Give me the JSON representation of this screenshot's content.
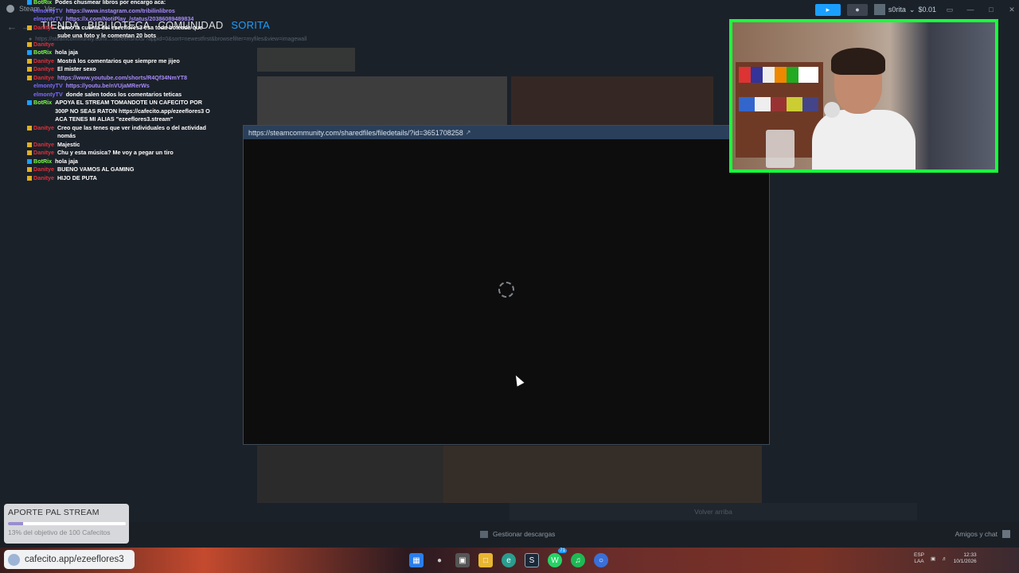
{
  "titlebar": {
    "app_name": "Steam",
    "menu_view": "Ver",
    "user_name": "s0rita",
    "balance": "$0.01"
  },
  "nav": {
    "tabs": [
      "TIENDA",
      "BIBLIOTECA",
      "COMUNIDAD",
      "SORITA"
    ],
    "active_tab": "SORITA",
    "url": "https://steamcommunity.com/.../screenshots/?appid=0&sort=newestfirst&browsefilter=myfiles&view=imagewall"
  },
  "chat": [
    {
      "user": "BotRix",
      "color": "#7cff4a",
      "badge": "#1a9fff",
      "msg": "Podes chusmear libros por encargo aca:"
    },
    {
      "user": "elmontyTV",
      "color": "#7d6bff",
      "badge": "",
      "msg": "https://www.instagram.com/tribilinlibros"
    },
    {
      "user": "elmontyTV",
      "color": "#7d6bff",
      "badge": "",
      "msg": "https://x.com/NotiPlay_/status/2038608948983​4"
    },
    {
      "user": "Danitye",
      "color": "#e0303a",
      "badge": "#e0b020",
      "msg": "Como la cuenta del ezeeflores3 esa toda boteada que sube una foto y le comentan 20 bots"
    },
    {
      "user": "Danitye",
      "color": "#e0303a",
      "badge": "#e0b020",
      "msg": ""
    },
    {
      "user": "BotRix",
      "color": "#7cff4a",
      "badge": "#1a9fff",
      "msg": "hola jaja"
    },
    {
      "user": "Danitye",
      "color": "#e0303a",
      "badge": "#e0b020",
      "msg": "Mostrá los comentarios que siempre me jijeo"
    },
    {
      "user": "Danitye",
      "color": "#e0303a",
      "badge": "#e0b020",
      "msg": "El mister sexo"
    },
    {
      "user": "Danitye",
      "color": "#e0303a",
      "badge": "#e0b020",
      "msg": "https://www.youtube.com/shorts/R4Qf34NmYT8"
    },
    {
      "user": "elmontyTV",
      "color": "#7d6bff",
      "badge": "",
      "msg": "https://youtu.be/nVUjaMRerWs"
    },
    {
      "user": "elmontyTV",
      "color": "#7d6bff",
      "badge": "",
      "msg": "donde salen todos los comentarios teticas"
    },
    {
      "user": "BotRix",
      "color": "#7cff4a",
      "badge": "#1a9fff",
      "msg": "APOYA EL STREAM TOMANDOTE UN CAFECITO POR 300P NO SEAS RATON https://cafecito.app/ezeeflores3 O ACA TENES MI ALIAS \"ezeeflores3.stream\""
    },
    {
      "user": "Danitye",
      "color": "#e0303a",
      "badge": "#e0b020",
      "msg": "Creo que las tenes que ver individuales o del actividad nomás"
    },
    {
      "user": "Danitye",
      "color": "#e0303a",
      "badge": "#e0b020",
      "msg": "Majestic"
    },
    {
      "user": "Danitye",
      "color": "#e0303a",
      "badge": "#e0b020",
      "msg": "Chu y esta música? Me voy a pegar un tiro"
    },
    {
      "user": "BotRix",
      "color": "#7cff4a",
      "badge": "#1a9fff",
      "msg": "hola jaja"
    },
    {
      "user": "Danitye",
      "color": "#e0303a",
      "badge": "#e0b020",
      "msg": "BUENO VAMOS AL GAMING"
    },
    {
      "user": "Danitye",
      "color": "#e0303a",
      "badge": "#e0b020",
      "msg": "HIJO DE PUTA"
    }
  ],
  "modal": {
    "url": "https://steamcommunity.com/sharedfiles/filedetails/?id=3651708258"
  },
  "donation": {
    "title": "APORTE PAL STREAM",
    "progress_pct": 13,
    "subtitle": "13% del objetivo de 100 Cafecitos"
  },
  "bottombar": {
    "downloads_label": "Gestionar descargas",
    "friends_label": "Amigos y chat",
    "back_to_top": "Volver arriba"
  },
  "taskbar": {
    "cafecito_link": "cafecito.app/ezeeflores3",
    "language": "ESP",
    "language_sub": "LAA",
    "badge_count": "71",
    "time": "12:33",
    "date": "10/1/2026"
  },
  "colors": {
    "accent": "#1a9fff",
    "webcam_border": "#19ff3c"
  }
}
